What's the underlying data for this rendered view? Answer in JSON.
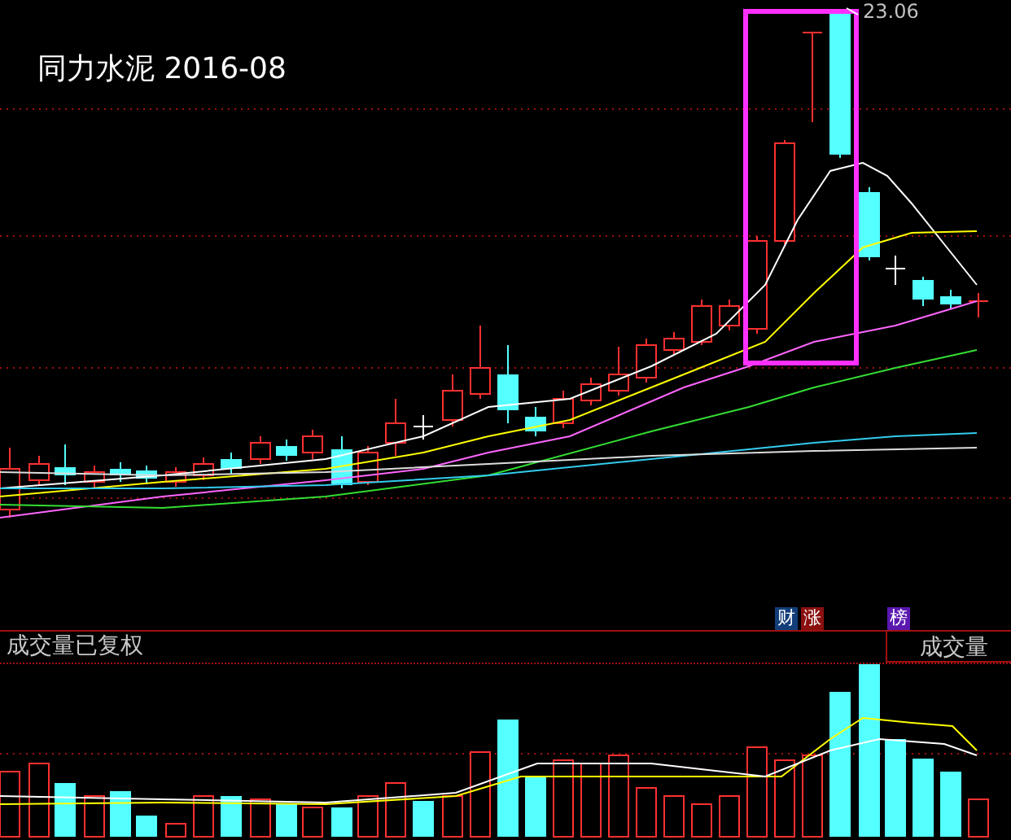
{
  "title": "同力水泥 2016-08",
  "high_label": "23.06",
  "badges": [
    {
      "text": "财",
      "color": "#123e7a"
    },
    {
      "text": "涨",
      "color": "#8a1010"
    },
    {
      "text": "榜",
      "color": "#5a18b0"
    }
  ],
  "volume_panel": {
    "label": "成交量已复权",
    "tab": "成交量"
  }
}
